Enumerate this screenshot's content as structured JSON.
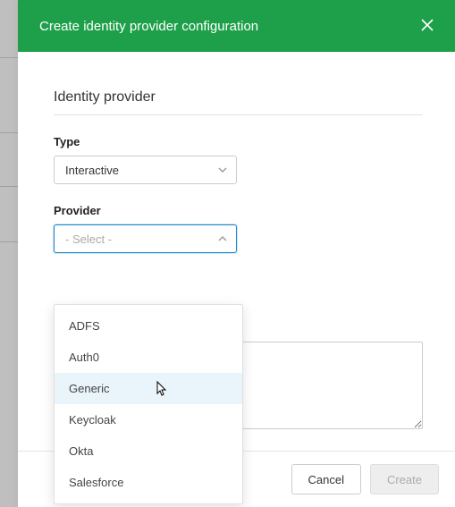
{
  "header": {
    "title": "Create identity provider configuration"
  },
  "section": {
    "heading": "Identity provider"
  },
  "fields": {
    "type": {
      "label": "Type",
      "value": "Interactive"
    },
    "provider": {
      "label": "Provider",
      "placeholder": "- Select -",
      "options": [
        "ADFS",
        "Auth0",
        "Generic",
        "Keycloak",
        "Okta",
        "Salesforce"
      ],
      "hovered_index": 2
    }
  },
  "footer": {
    "cancel": "Cancel",
    "create": "Create"
  }
}
